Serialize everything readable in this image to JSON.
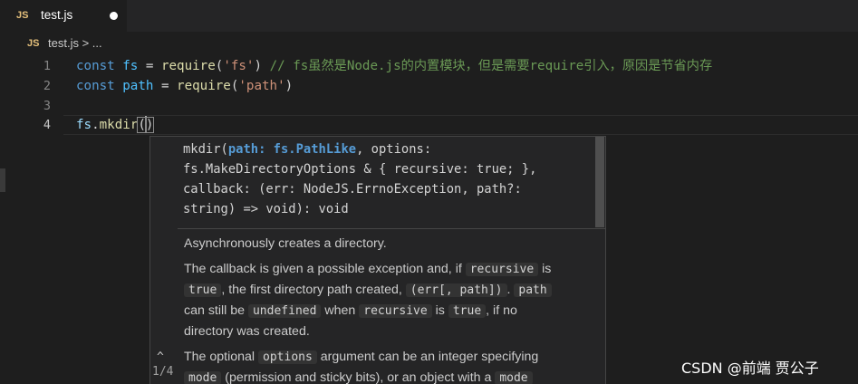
{
  "tab": {
    "badge": "JS",
    "filename": "test.js"
  },
  "breadcrumb": {
    "badge": "JS",
    "path": "test.js > ..."
  },
  "editor": {
    "lines": [
      {
        "number": "1",
        "tokens": [
          [
            "const ",
            "kw"
          ],
          [
            "fs",
            "var"
          ],
          [
            " = ",
            ""
          ],
          [
            "require",
            "fn"
          ],
          [
            "(",
            ""
          ],
          [
            "'fs'",
            "str"
          ],
          [
            ") ",
            ""
          ],
          [
            "// fs虽然是Node.js的内置模块，但是需要require引入，原因是节省内存",
            "cm"
          ]
        ]
      },
      {
        "number": "2",
        "tokens": [
          [
            "const ",
            "kw"
          ],
          [
            "path",
            "var"
          ],
          [
            " = ",
            ""
          ],
          [
            "require",
            "fn"
          ],
          [
            "(",
            ""
          ],
          [
            "'path'",
            "str"
          ],
          [
            ")",
            ""
          ]
        ]
      },
      {
        "number": "3",
        "tokens": []
      },
      {
        "number": "4",
        "tokens": [
          [
            "fs",
            "prop"
          ],
          [
            ".",
            ""
          ],
          [
            "mkdir",
            "fn"
          ]
        ]
      }
    ]
  },
  "hover": {
    "signature": [
      [
        [
          "mkdir(",
          ""
        ],
        [
          "path: fs.PathLike",
          "b"
        ],
        [
          ", options:",
          ""
        ]
      ],
      [
        [
          "fs.MakeDirectoryOptions & { recursive: true; },",
          ""
        ]
      ],
      [
        [
          "callback: (err: NodeJS.ErrnoException, path?:",
          ""
        ]
      ],
      [
        [
          "string) => void): void",
          ""
        ]
      ]
    ],
    "doc": [
      [
        [
          "Asynchronously creates a directory.",
          "t"
        ]
      ],
      [
        [
          "The callback is given a possible exception and, if ",
          "t"
        ],
        [
          "recursive",
          "c"
        ],
        [
          " is ",
          "t"
        ],
        [
          "true",
          "c"
        ],
        [
          ", the first directory path created, ",
          "t"
        ],
        [
          "(err[, path])",
          "c"
        ],
        [
          ". ",
          "t"
        ],
        [
          "path",
          "c"
        ],
        [
          " can still be ",
          "t"
        ],
        [
          "undefined",
          "c"
        ],
        [
          " when ",
          "t"
        ],
        [
          "recursive",
          "c"
        ],
        [
          " is ",
          "t"
        ],
        [
          "true",
          "c"
        ],
        [
          ", if no directory was created.",
          "t"
        ]
      ],
      [
        [
          "The optional ",
          "t"
        ],
        [
          "options",
          "c"
        ],
        [
          " argument can be an integer specifying ",
          "t"
        ],
        [
          "mode",
          "c"
        ],
        [
          " (permission and sticky bits), or an object with a ",
          "t"
        ],
        [
          "mode",
          "c"
        ]
      ]
    ],
    "nav_up": "^",
    "nav_count": "1/4"
  },
  "watermark": "CSDN @前端 贾公子"
}
